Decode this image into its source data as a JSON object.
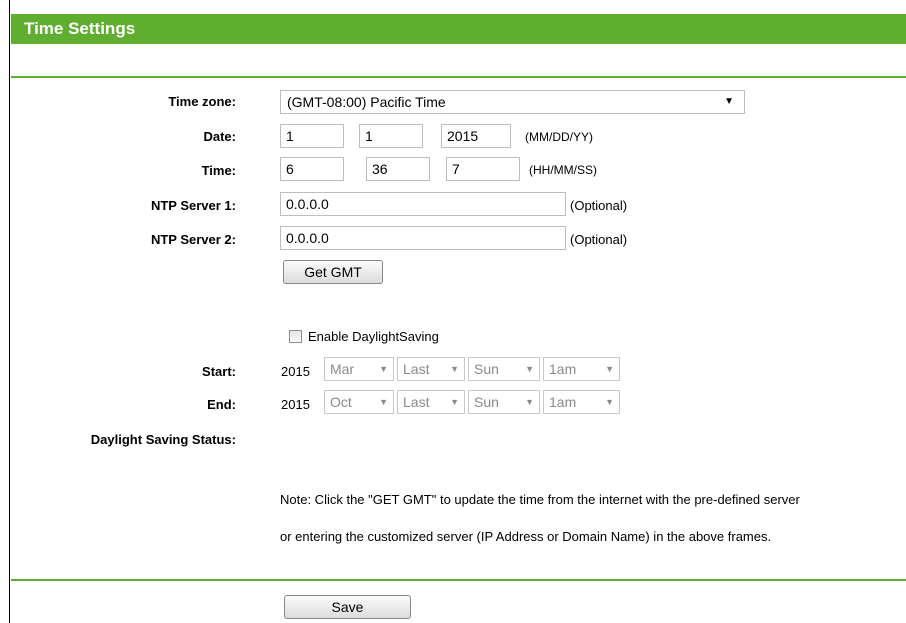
{
  "header": {
    "title": "Time Settings"
  },
  "form": {
    "time_zone_label": "Time zone:",
    "time_zone_value": "(GMT-08:00) Pacific Time",
    "date_label": "Date:",
    "date_month": "1",
    "date_day": "1",
    "date_year": "2015",
    "date_format": "(MM/DD/YY)",
    "time_label": "Time:",
    "time_hour": "6",
    "time_minute": "36",
    "time_second": "7",
    "time_format": "(HH/MM/SS)",
    "ntp1_label": "NTP Server 1:",
    "ntp1_value": "0.0.0.0",
    "ntp2_label": "NTP Server 2:",
    "ntp2_value": "0.0.0.0",
    "optional_hint": "(Optional)",
    "get_gmt_label": "Get GMT"
  },
  "dst": {
    "checkbox_label": "Enable DaylightSaving",
    "checked": false,
    "start_label": "Start:",
    "start_year": "2015",
    "start_month": "Mar",
    "start_week": "Last",
    "start_day": "Sun",
    "start_hour": "1am",
    "end_label": "End:",
    "end_year": "2015",
    "end_month": "Oct",
    "end_week": "Last",
    "end_day": "Sun",
    "end_hour": "1am",
    "status_label": "Daylight Saving Status:"
  },
  "note": {
    "line1": "Note: Click the \"GET GMT\" to update the time from the internet with the pre-defined server",
    "line2": "or entering the customized server (IP Address or Domain Name) in the above frames."
  },
  "footer": {
    "save_label": "Save"
  },
  "colors": {
    "accent": "#5fae30"
  }
}
